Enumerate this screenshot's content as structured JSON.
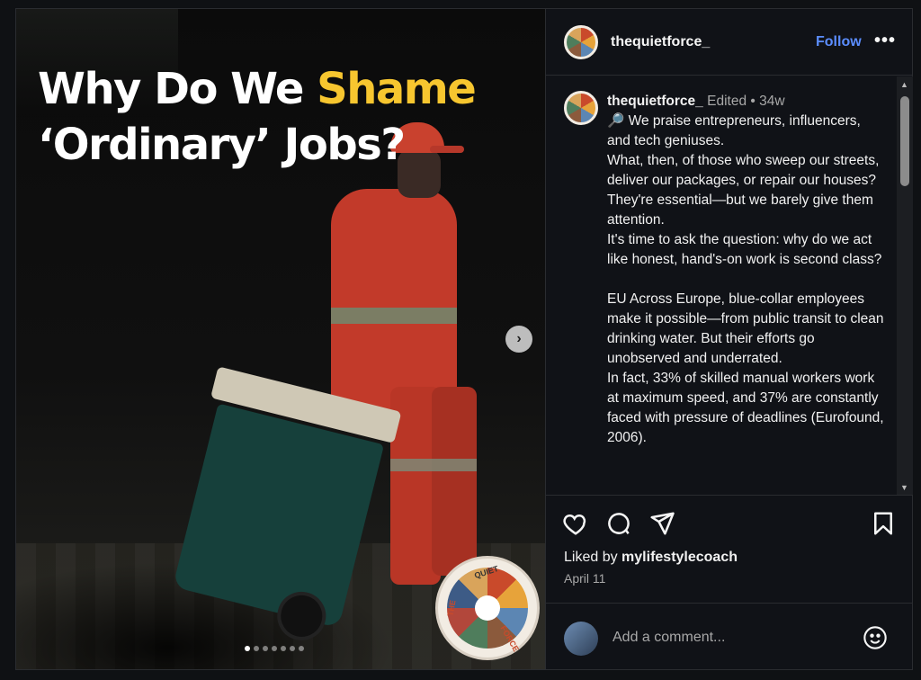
{
  "post": {
    "headline_part1": "Why Do We ",
    "headline_accent": "Shame",
    "headline_line2": "‘Ordinary’ Jobs?",
    "next_icon": "›",
    "carousel_dots": 7,
    "active_dot": 0
  },
  "header": {
    "username": "thequietforce_",
    "follow_label": "Follow",
    "more_label": "•••"
  },
  "caption": {
    "username": "thequietforce_",
    "edited": "Edited",
    "separator": "•",
    "age": "34w",
    "lines": [
      "🔎 We praise entrepreneurs, influencers, and tech geniuses.",
      "What, then, of those who sweep our streets, deliver our packages, or repair our houses?",
      "They're essential—but we barely give them attention.",
      "It's time to ask the question: why do we act like honest, hand's-on work is second class?",
      "",
      "EU Across Europe, blue-collar employees make it possible—from public transit to clean drinking water. But their efforts go unobserved and underrated.",
      "In fact, 33% of skilled manual workers work at maximum speed, and 37% are constantly faced with pressure of deadlines (Eurofound, 2006)."
    ]
  },
  "actions": {
    "like_icon": "heart-icon",
    "comment_icon": "comment-icon",
    "share_icon": "share-icon",
    "save_icon": "bookmark-icon"
  },
  "likes": {
    "prefix": "Liked by ",
    "user": "mylifestylecoach"
  },
  "date": "April 11",
  "comment": {
    "placeholder": "Add a comment..."
  },
  "badge": {
    "top": "QUIET",
    "left": "THE",
    "bottom": "FORCE"
  },
  "colors": {
    "accent_yellow": "#f7c62f",
    "follow_blue": "#5b8dff",
    "panel_bg": "#101217"
  }
}
